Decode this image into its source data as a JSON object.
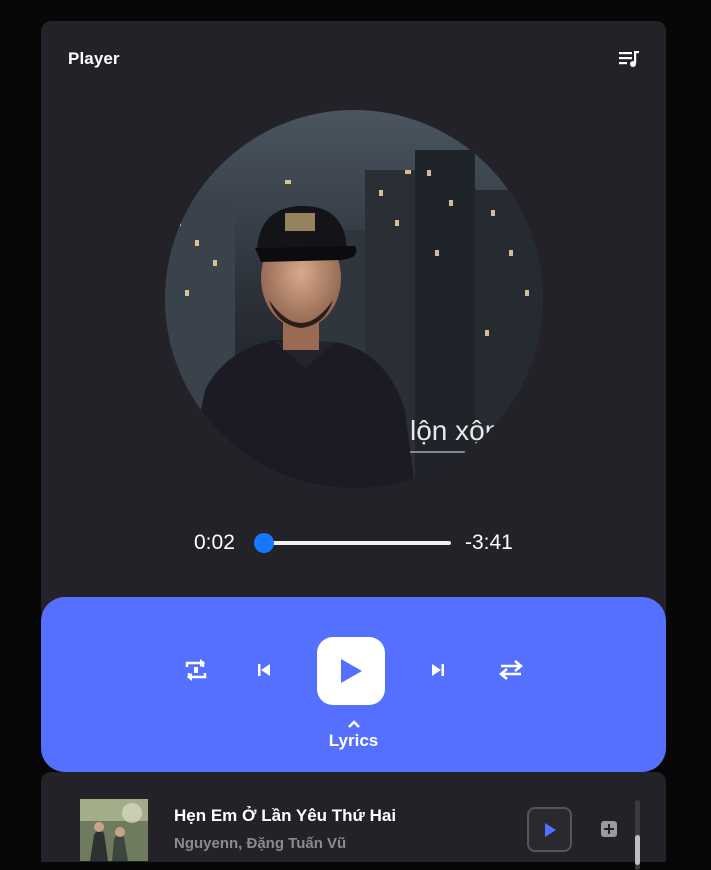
{
  "player": {
    "title": "Player",
    "queue_icon": "queue-music-icon",
    "album_art_text": "lộn xộn",
    "current_time": "0:02",
    "remaining_time": "-3:41",
    "progress": 0.01
  },
  "controls": {
    "repeat_icon": "repeat-icon",
    "previous_icon": "skip-previous-icon",
    "play_icon": "play-icon",
    "next_icon": "skip-next-icon",
    "shuffle_icon": "shuffle-icon",
    "lyrics_label": "Lyrics",
    "lyrics_icon": "chevron-up-icon"
  },
  "queue": {
    "items": [
      {
        "title": "Hẹn Em Ở Lần Yêu Thứ Hai",
        "artist": "Nguyenn, Đặng Tuấn Vũ"
      }
    ]
  },
  "colors": {
    "background": "#070708",
    "card": "#232228",
    "accent": "#5570ff",
    "progress_thumb": "#1677ff"
  }
}
